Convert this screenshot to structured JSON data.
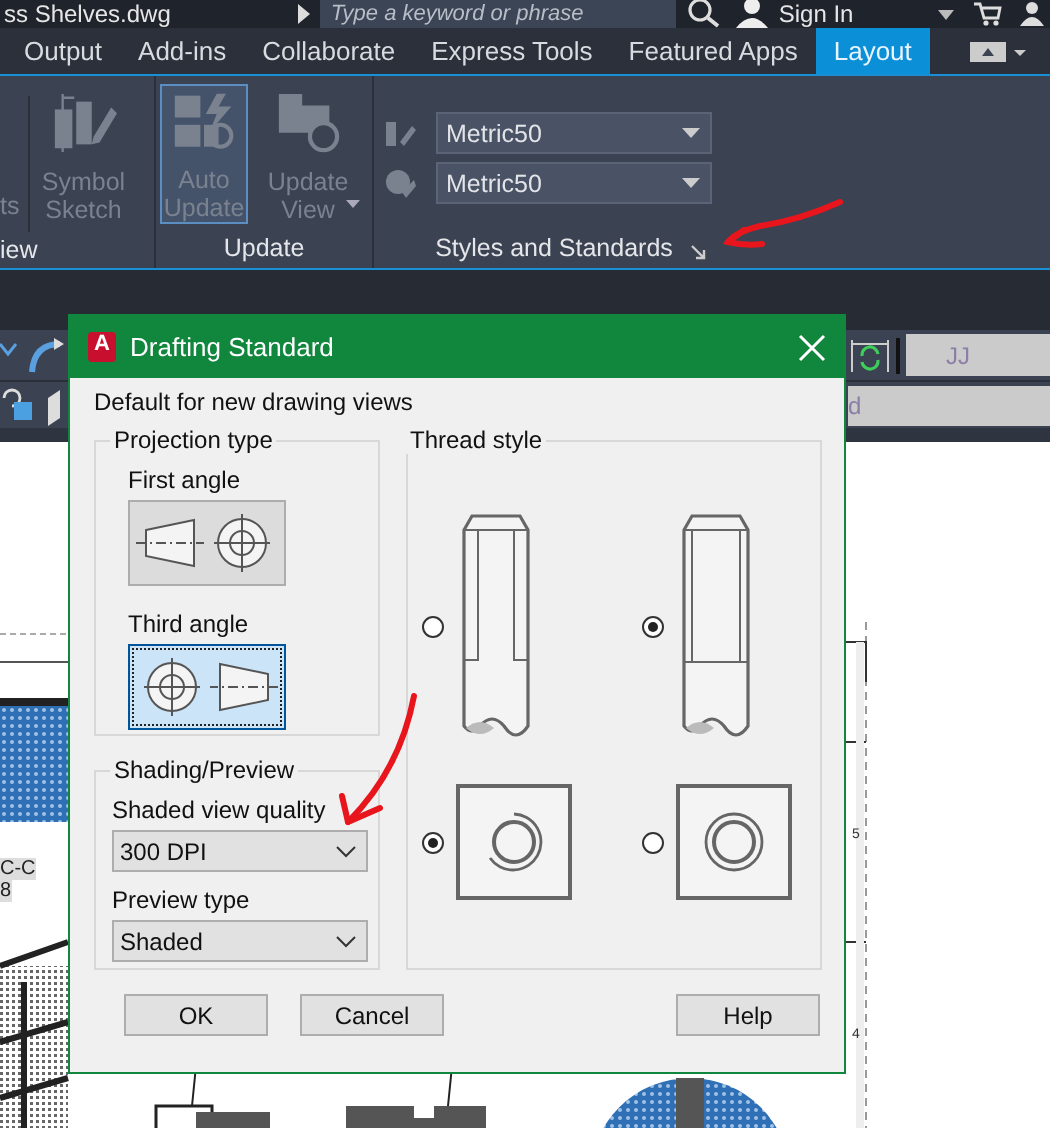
{
  "title_bar": {
    "file_name": "ss Shelves.dwg",
    "search": {
      "placeholder": "Type a keyword or phrase"
    },
    "sign_in": "Sign In"
  },
  "ribbon_tabs": [
    {
      "label": "Output",
      "selected": false
    },
    {
      "label": "Add-ins",
      "selected": false
    },
    {
      "label": "Collaborate",
      "selected": false
    },
    {
      "label": "Express Tools",
      "selected": false
    },
    {
      "label": "Featured Apps",
      "selected": false
    },
    {
      "label": "Layout",
      "selected": true
    }
  ],
  "ribbon": {
    "panels": [
      {
        "label": "iew",
        "cut_tool": "ts",
        "tools": [
          {
            "kind": "sketch",
            "label": "Symbol Sketch",
            "active": false,
            "has_menu": false
          }
        ]
      },
      {
        "label": "Update",
        "tools": [
          {
            "kind": "update",
            "label": "Auto Update",
            "active": true,
            "has_menu": false
          },
          {
            "kind": "view",
            "label": "Update View",
            "active": false,
            "has_menu": true
          }
        ]
      },
      {
        "label": "Styles and Standards",
        "dropdowns": [
          "Metric50",
          "Metric50"
        ],
        "launcher": true
      }
    ]
  },
  "toolbar": {
    "fields": [
      "JJ",
      "d"
    ]
  },
  "drawing": {
    "section_labels": [
      "C-C",
      "8"
    ],
    "sheet_marks": [
      "5",
      "4"
    ]
  },
  "dialog": {
    "icon_letter": "A",
    "title": "Drafting Standard",
    "subtitle": "Default for new drawing views",
    "projection": {
      "title": "Projection type",
      "options": [
        {
          "label": "First angle",
          "selected": false
        },
        {
          "label": "Third angle",
          "selected": true
        }
      ]
    },
    "thread_style": {
      "title": "Thread style",
      "side_options": [
        {
          "selected": false
        },
        {
          "selected": true
        }
      ],
      "end_options": [
        {
          "selected": true
        },
        {
          "selected": false
        }
      ]
    },
    "shading": {
      "title": "Shading/Preview",
      "fields": [
        {
          "label": "Shaded view quality",
          "value": "300 DPI"
        },
        {
          "label": "Preview type",
          "value": "Shaded"
        }
      ]
    },
    "buttons": [
      "OK",
      "Cancel",
      "Help"
    ]
  }
}
